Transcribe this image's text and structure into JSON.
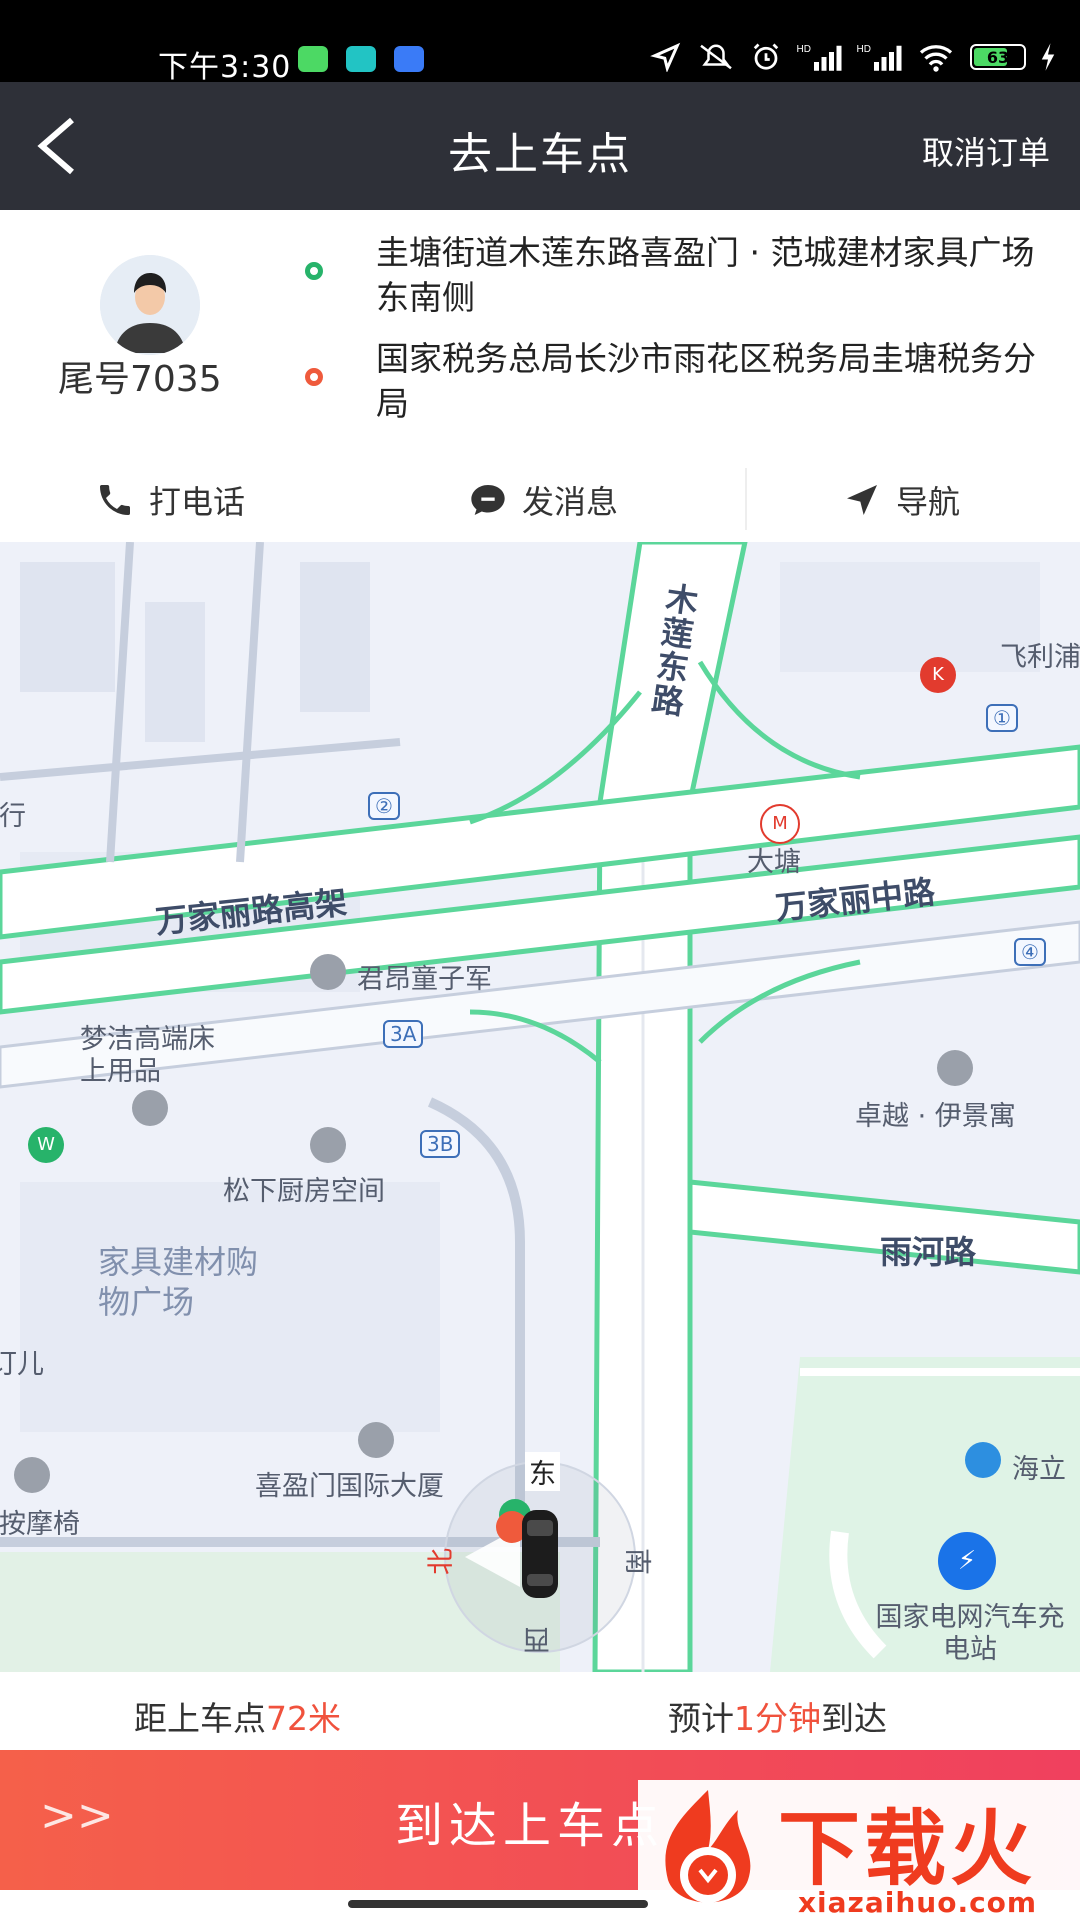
{
  "status_bar": {
    "time": "下午3:30",
    "battery": "63",
    "icons": [
      "location-icon",
      "mute-icon",
      "alarm-icon",
      "signal-hd-1-icon",
      "signal-hd-2-icon",
      "wifi-icon",
      "battery-icon",
      "charging-icon"
    ]
  },
  "header": {
    "title": "去上车点",
    "cancel_label": "取消订单"
  },
  "passenger": {
    "tail_label": "尾号7035"
  },
  "route": {
    "from": "圭塘街道木莲东路喜盈门 · 范城建材家具广场东南侧",
    "to": "国家税务总局长沙市雨花区税务局圭塘税务分局"
  },
  "actions": {
    "call": "打电话",
    "message": "发消息",
    "navigate": "导航"
  },
  "map": {
    "roads": {
      "elevated": "万家丽路高架",
      "mid": "万家丽中路",
      "yuhe": "雨河路",
      "mulian": "木莲东路"
    },
    "pois": {
      "bank": "银行",
      "feili": "飞利浦",
      "datang": "大塘",
      "junang": "君昂童子军",
      "mengjie": "梦洁高端床上用品",
      "songxia": "松下厨房空间",
      "furniture_mall": "家具建材购物广场",
      "xiyingmen": "喜盈门国际大厦",
      "zhuoyue": "卓越 · 伊景寓",
      "haili": "海立",
      "grid_station": "国家电网汽车充电站",
      "left_partial_1": "订儿",
      "left_partial_2": "泰按摩椅"
    },
    "exits": [
      "①",
      "②",
      "3A",
      "3B",
      "④"
    ],
    "compass": {
      "east": "东",
      "south": "南",
      "west": "西",
      "north": "北"
    },
    "colors": {
      "road_green": "#5bd69a",
      "road_fill": "#ffffff",
      "map_bg": "#eef1f9",
      "park": "#dff3e6"
    }
  },
  "trip": {
    "distance_prefix": "距上车点",
    "distance_value": "72米",
    "eta_prefix": "预计",
    "eta_value": "1分钟",
    "eta_suffix": "到达"
  },
  "slide_button": {
    "chevrons": ">>",
    "label": "到达上车点"
  },
  "watermark": {
    "brand": "下载火",
    "url": "xiazaihuo.com"
  },
  "colors": {
    "header_bg": "#2e3038",
    "accent": "#f0523d",
    "origin_dot": "#27b36a",
    "dest_dot": "#ef5a3c"
  }
}
